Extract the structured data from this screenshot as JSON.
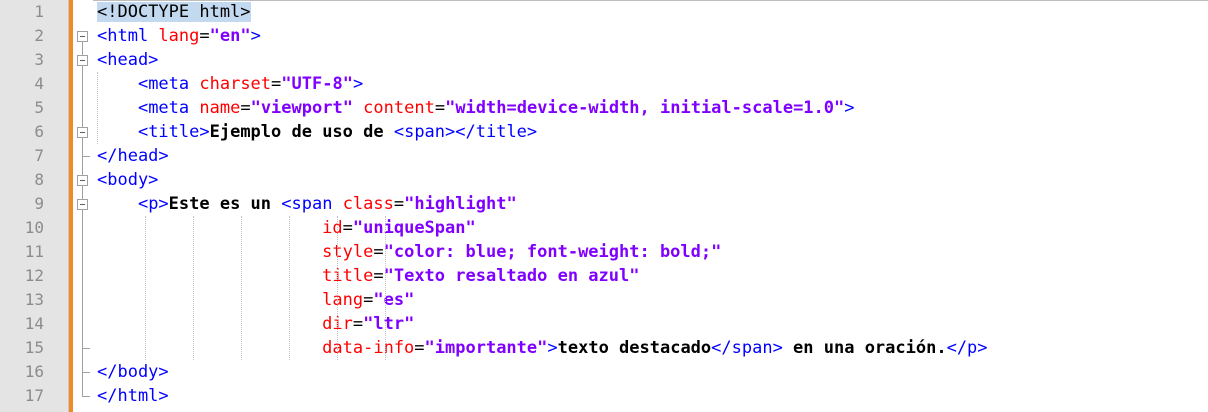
{
  "editor": {
    "line_numbers": [
      "1",
      "2",
      "3",
      "4",
      "5",
      "6",
      "7",
      "8",
      "9",
      "10",
      "11",
      "12",
      "13",
      "14",
      "15",
      "16",
      "17"
    ],
    "lines": [
      [
        {
          "t": "<!DOCTYPE html>",
          "c": "doctype"
        }
      ],
      [
        {
          "t": "<html",
          "c": "tag"
        },
        {
          "t": " lang",
          "c": "attr"
        },
        {
          "t": "=",
          "c": "eq"
        },
        {
          "t": "\"en\"",
          "c": "val"
        },
        {
          "t": ">",
          "c": "tag"
        }
      ],
      [
        {
          "t": "<head>",
          "c": "tag"
        }
      ],
      [
        {
          "t": "    "
        },
        {
          "t": "<meta",
          "c": "tag"
        },
        {
          "t": " charset",
          "c": "attr"
        },
        {
          "t": "=",
          "c": "eq"
        },
        {
          "t": "\"UTF-8\"",
          "c": "val"
        },
        {
          "t": ">",
          "c": "tag"
        }
      ],
      [
        {
          "t": "    "
        },
        {
          "t": "<meta",
          "c": "tag"
        },
        {
          "t": " name",
          "c": "attr"
        },
        {
          "t": "=",
          "c": "eq"
        },
        {
          "t": "\"viewport\"",
          "c": "val"
        },
        {
          "t": " content",
          "c": "attr"
        },
        {
          "t": "=",
          "c": "eq"
        },
        {
          "t": "\"width=device-width, initial-scale=1.0\"",
          "c": "val"
        },
        {
          "t": ">",
          "c": "tag"
        }
      ],
      [
        {
          "t": "    "
        },
        {
          "t": "<title>",
          "c": "tag"
        },
        {
          "t": "Ejemplo de uso de ",
          "c": "txt"
        },
        {
          "t": "<span>",
          "c": "tag"
        },
        {
          "t": "</title>",
          "c": "tag"
        }
      ],
      [
        {
          "t": "</head>",
          "c": "tag"
        }
      ],
      [
        {
          "t": "<body>",
          "c": "tag"
        }
      ],
      [
        {
          "t": "    "
        },
        {
          "t": "<p>",
          "c": "tag"
        },
        {
          "t": "Este es un ",
          "c": "txt"
        },
        {
          "t": "<span",
          "c": "tag"
        },
        {
          "t": " class",
          "c": "attr"
        },
        {
          "t": "=",
          "c": "eq"
        },
        {
          "t": "\"highlight\"",
          "c": "val"
        }
      ],
      [
        {
          "t": "                      "
        },
        {
          "t": "id",
          "c": "attr"
        },
        {
          "t": "=",
          "c": "eq"
        },
        {
          "t": "\"uniqueSpan\"",
          "c": "val"
        }
      ],
      [
        {
          "t": "                      "
        },
        {
          "t": "style",
          "c": "attr"
        },
        {
          "t": "=",
          "c": "eq"
        },
        {
          "t": "\"color: blue; font-weight: bold;\"",
          "c": "val"
        }
      ],
      [
        {
          "t": "                      "
        },
        {
          "t": "title",
          "c": "attr"
        },
        {
          "t": "=",
          "c": "eq"
        },
        {
          "t": "\"Texto resaltado en azul\"",
          "c": "val"
        }
      ],
      [
        {
          "t": "                      "
        },
        {
          "t": "lang",
          "c": "attr"
        },
        {
          "t": "=",
          "c": "eq"
        },
        {
          "t": "\"es\"",
          "c": "val"
        }
      ],
      [
        {
          "t": "                      "
        },
        {
          "t": "dir",
          "c": "attr"
        },
        {
          "t": "=",
          "c": "eq"
        },
        {
          "t": "\"ltr\"",
          "c": "val"
        }
      ],
      [
        {
          "t": "                      "
        },
        {
          "t": "data-info",
          "c": "attr"
        },
        {
          "t": "=",
          "c": "eq"
        },
        {
          "t": "\"importante\"",
          "c": "val"
        },
        {
          "t": ">",
          "c": "tag"
        },
        {
          "t": "texto destacado",
          "c": "txt"
        },
        {
          "t": "</span>",
          "c": "tag"
        },
        {
          "t": " en una oración.",
          "c": "txt"
        },
        {
          "t": "</p>",
          "c": "tag"
        }
      ],
      [
        {
          "t": "</body>",
          "c": "tag"
        }
      ],
      [
        {
          "t": "</html>",
          "c": "tag"
        }
      ]
    ],
    "colors": {
      "tag": "#0000ff",
      "attribute": "#ff0000",
      "value": "#8000ff",
      "text": "#000000",
      "gutter_bg": "#e4e4e4",
      "change_bar": "#f08a24",
      "selection": "#c3d9f0"
    }
  }
}
